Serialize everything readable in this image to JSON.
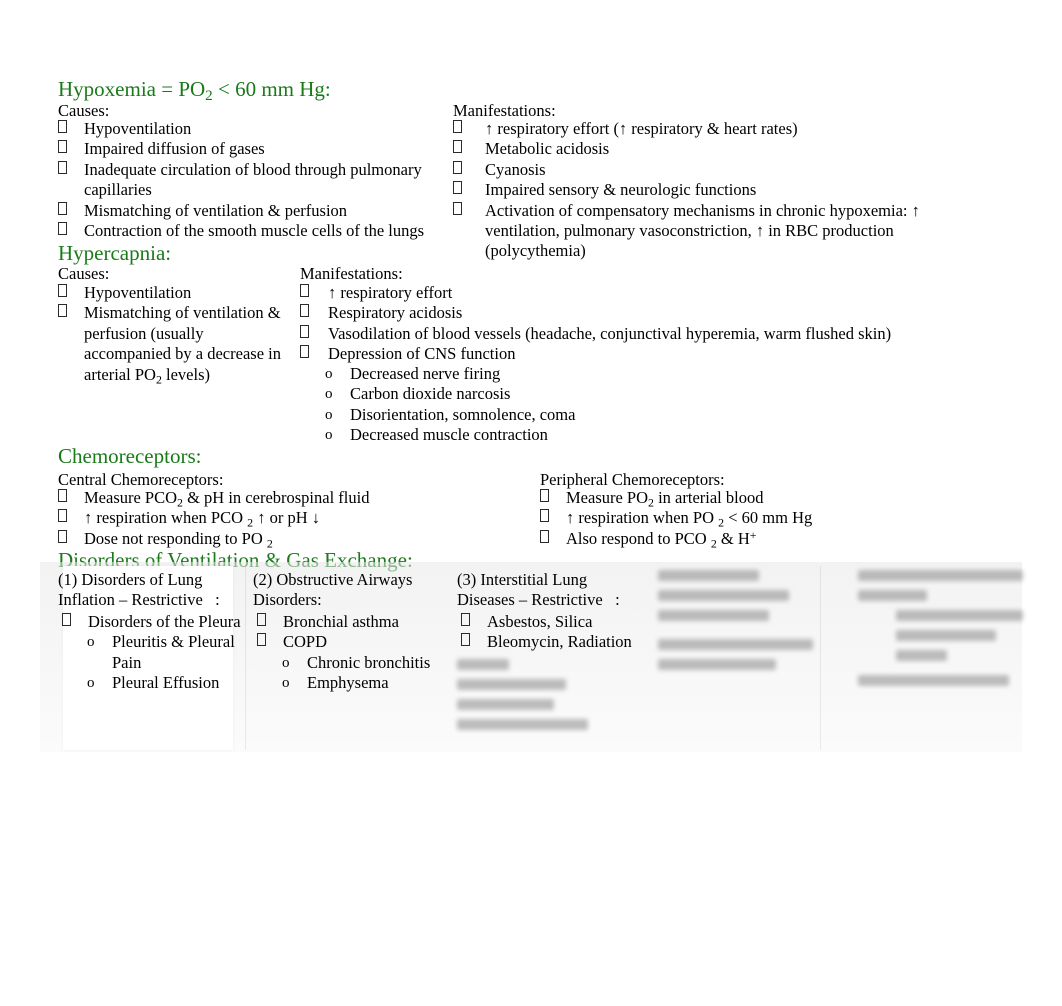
{
  "theme": {
    "heading_color": "#1a7a1a",
    "text_color": "#000000"
  },
  "hypoxemia": {
    "heading_pre": "Hypoxemia = PO",
    "heading_sub": "2",
    "heading_post": " < 60 mm Hg:",
    "causes_label": "Causes:",
    "causes": [
      "Hypoventilation",
      "Impaired diffusion of gases",
      "Inadequate circulation of blood through pulmonary capillaries",
      "Mismatching of ventilation & perfusion",
      "Contraction of the smooth muscle cells of the lungs"
    ],
    "manifestations_label": "Manifestations:",
    "manifestations": [
      "↑ respiratory effort (↑ respiratory & heart rates)",
      "Metabolic acidosis",
      "Cyanosis",
      "Impaired sensory & neurologic functions",
      "Activation of compensatory mechanisms in chronic hypoxemia: ↑ ventilation, pulmonary vasoconstriction, ↑ in RBC production (polycythemia)"
    ]
  },
  "hypercapnia": {
    "heading": "Hypercapnia:",
    "causes_label": "Causes:",
    "causes": [
      "Hypoventilation",
      "Mismatching of ventilation & perfusion (usually accompanied by a decrease in arterial PO"
    ],
    "causes_2_sub": "2",
    "causes_2_tail": " levels)",
    "manifestations_label": "Manifestations:",
    "manifestations": [
      "↑ respiratory effort",
      "Respiratory acidosis",
      "Vasodilation of blood vessels (headache, conjunctival hyperemia, warm flushed skin)",
      "Depression of CNS function"
    ],
    "cns_sub": [
      "Decreased nerve firing",
      "Carbon dioxide narcosis",
      "Disorientation, somnolence, coma",
      "Decreased muscle contraction"
    ]
  },
  "chemoreceptors": {
    "heading": "Chemoreceptors:",
    "central_label": "Central Chemoreceptors:",
    "central": [
      {
        "pre": "Measure PCO",
        "sub": "2",
        "post": " & pH in cerebrospinal fluid"
      },
      {
        "pre": "↑ respiration when PCO ",
        "sub": "2",
        "post": " ↑ or pH ↓"
      },
      {
        "pre": "Dose not responding to PO ",
        "sub": "2",
        "post": ""
      }
    ],
    "peripheral_label": "Peripheral Chemoreceptors:",
    "peripheral": [
      {
        "pre": "Measure PO",
        "sub": "2",
        "post": " in arterial blood"
      },
      {
        "pre": "↑ respiration when PO ",
        "sub": "2",
        "post": " < 60 mm Hg"
      },
      {
        "pre": "Also respond to PCO ",
        "sub": "2",
        "post": " & H",
        "sup": "+"
      }
    ]
  },
  "disorders": {
    "heading": "Disorders of Ventilation & Gas Exchange:",
    "columns": [
      {
        "title_line1": "(1) Disorders of Lung",
        "title_line2": "Inflation – Restrictive",
        "title_line3": ":",
        "bullets": [
          "Disorders of the Pleura"
        ],
        "subbullets": [
          "Pleuritis & Pleural Pain",
          "Pleural Effusion"
        ]
      },
      {
        "title_line1": "(2) Obstructive Airways",
        "title_line2": "Disorders:",
        "title_line3": "",
        "bullets": [
          "Bronchial asthma",
          "COPD"
        ],
        "subbullets": [
          "Chronic bronchitis",
          "Emphysema"
        ]
      },
      {
        "title_line1": "(3) Interstitial Lung",
        "title_line2": "Diseases – Restrictive",
        "title_line3": ":",
        "bullets": [
          "Asbestos, Silica",
          "Bleomycin, Radiation"
        ],
        "subbullets": []
      },
      {
        "title_line1": "",
        "title_line2": "",
        "title_line3": "",
        "bullets": [],
        "subbullets": []
      },
      {
        "title_line1": "",
        "title_line2": "",
        "title_line3": "",
        "bullets": [],
        "subbullets": []
      }
    ]
  }
}
